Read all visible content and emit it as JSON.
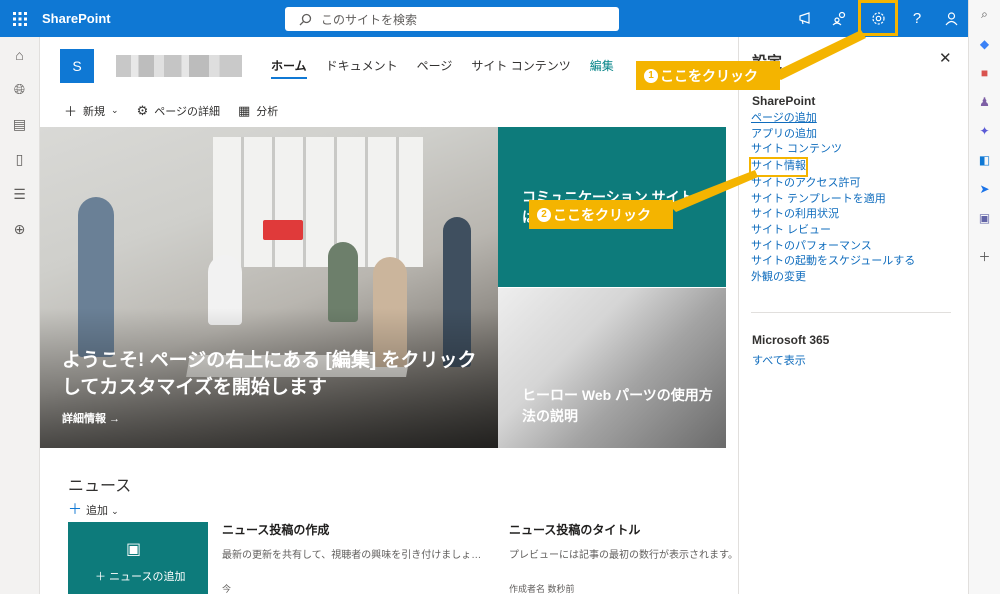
{
  "topbar": {
    "app_name": "SharePoint",
    "search_placeholder": "このサイトを検索",
    "icons": [
      "megaphone-icon",
      "share-people-icon",
      "gear-icon",
      "help-icon",
      "account-icon"
    ],
    "help_glyph": "?"
  },
  "site": {
    "logo_letter": "S",
    "nav": [
      "ホーム",
      "ドキュメント",
      "ページ",
      "サイト コンテンツ",
      "編集"
    ],
    "active_nav": "ホーム"
  },
  "commandbar": {
    "new_label": "新規",
    "page_details_label": "ページの詳細",
    "analytics_label": "分析"
  },
  "hero": {
    "main_title": "ようこそ! ページの右上にある [編集] をクリックしてカスタマイズを開始します",
    "main_more": "詳細情報 →",
    "tile_teal_text": "コミュニケーション サイト",
    "tile_teal_text2": "は",
    "tile_arch_text": "ヒーロー Web パーツの使用方法の説明"
  },
  "news": {
    "title": "ニュース",
    "add_label": "追加",
    "card_label": "＋ ニュースの追加",
    "items": [
      {
        "headline": "ニュース投稿の作成",
        "desc": "最新の更新を共有して、視聴者の興味を引き付けましょ…",
        "author": "今"
      },
      {
        "headline": "ニュース投稿のタイトル",
        "desc": "プレビューには記事の最初の数行が表示されます。",
        "author": "作成者名 数秒前"
      }
    ]
  },
  "settings_panel": {
    "title": "設定",
    "section1": "SharePoint",
    "links": [
      "ページの追加",
      "アプリの追加",
      "サイト コンテンツ",
      "サイト情報",
      "サイトのアクセス許可",
      "サイト テンプレートを適用",
      "サイトの利用状況",
      "サイト レビュー",
      "サイトのパフォーマンス",
      "サイトの起動をスケジュールする",
      "外観の変更"
    ],
    "section2": "Microsoft 365",
    "show_all": "すべて表示"
  },
  "annotations": {
    "callout1_num": "1",
    "callout1_text": "ここをクリック",
    "callout2_num": "2",
    "callout2_text": "ここをクリック",
    "color": "#f4b400"
  },
  "colors": {
    "brand": "#0f78d4",
    "teal": "#0d7b7b",
    "link": "#0f6cbd"
  }
}
